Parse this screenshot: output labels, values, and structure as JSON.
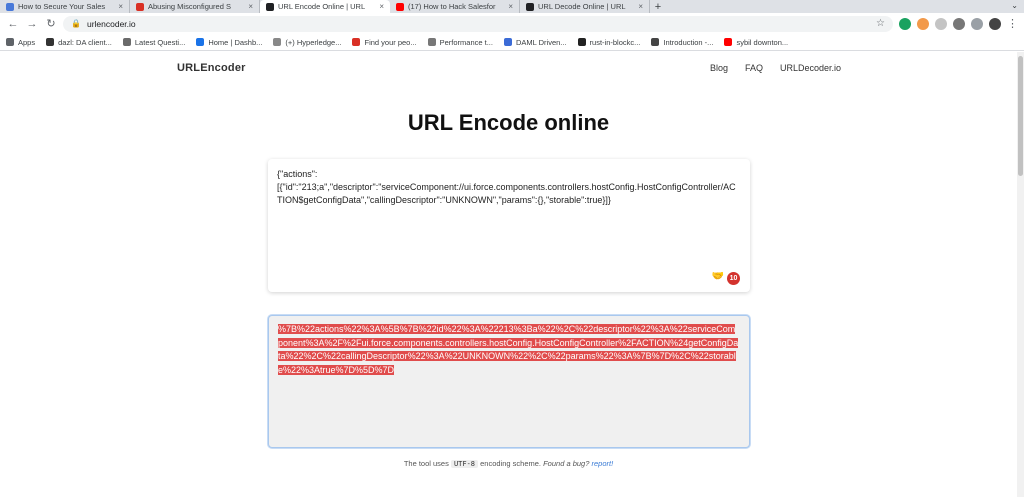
{
  "browser": {
    "tabs": [
      {
        "title": "How to Secure Your Sales",
        "color": "#4a7ad9",
        "active": false
      },
      {
        "title": "Abusing Misconfigured S",
        "color": "#d93025",
        "active": false
      },
      {
        "title": "URL Encode Online | URL",
        "color": "#202124",
        "active": true
      },
      {
        "title": "(17) How to Hack Salesfor",
        "color": "#ff0000",
        "active": false
      },
      {
        "title": "URL Decode Online | URL",
        "color": "#202124",
        "active": false
      }
    ],
    "url": "urlencoder.io",
    "bookmarks": [
      {
        "label": "Apps",
        "color": "#5f6368"
      },
      {
        "label": "dazl: DA client...",
        "color": "#333333"
      },
      {
        "label": "Latest Questi...",
        "color": "#6a6a6a"
      },
      {
        "label": "Home | Dashb...",
        "color": "#1a73e8"
      },
      {
        "label": "(+) Hyperledge...",
        "color": "#888888"
      },
      {
        "label": "Find your peo...",
        "color": "#d93025"
      },
      {
        "label": "Performance t...",
        "color": "#777777"
      },
      {
        "label": "DAML Driven...",
        "color": "#3b6bd6"
      },
      {
        "label": "rust-in-blockc...",
        "color": "#222222"
      },
      {
        "label": "Introduction -...",
        "color": "#444444"
      },
      {
        "label": "sybil downton...",
        "color": "#ff0000"
      }
    ]
  },
  "site": {
    "brand": "URLEncoder",
    "nav": [
      "Blog",
      "FAQ",
      "URLDecoder.io"
    ],
    "title": "URL Encode online"
  },
  "input": {
    "text": "{\"actions\":\n[{\"id\":\"213;a\",\"descriptor\":\"serviceComponent://ui.force.components.controllers.hostConfig.HostConfigController/ACTION$getConfigData\",\"callingDescriptor\":\"UNKNOWN\",\"params\":{},\"storable\":true}]}"
  },
  "output": {
    "text": "%7B%22actions%22%3A%5B%7B%22id%22%3A%22213%3Ba%22%2C%22descriptor%22%3A%22serviceComponent%3A%2F%2Fui.force.components.controllers.hostConfig.HostConfigController%2FACTION%24getConfigData%22%2C%22callingDescriptor%22%3A%22UNKNOWN%22%2C%22params%22%3A%7B%7D%2C%22storable%22%3Atrue%7D%5D%7D"
  },
  "footer": {
    "pre": "The tool uses",
    "code": "UTF-8",
    "post": "encoding scheme.",
    "bug": "Found a bug?",
    "link": "report!"
  }
}
